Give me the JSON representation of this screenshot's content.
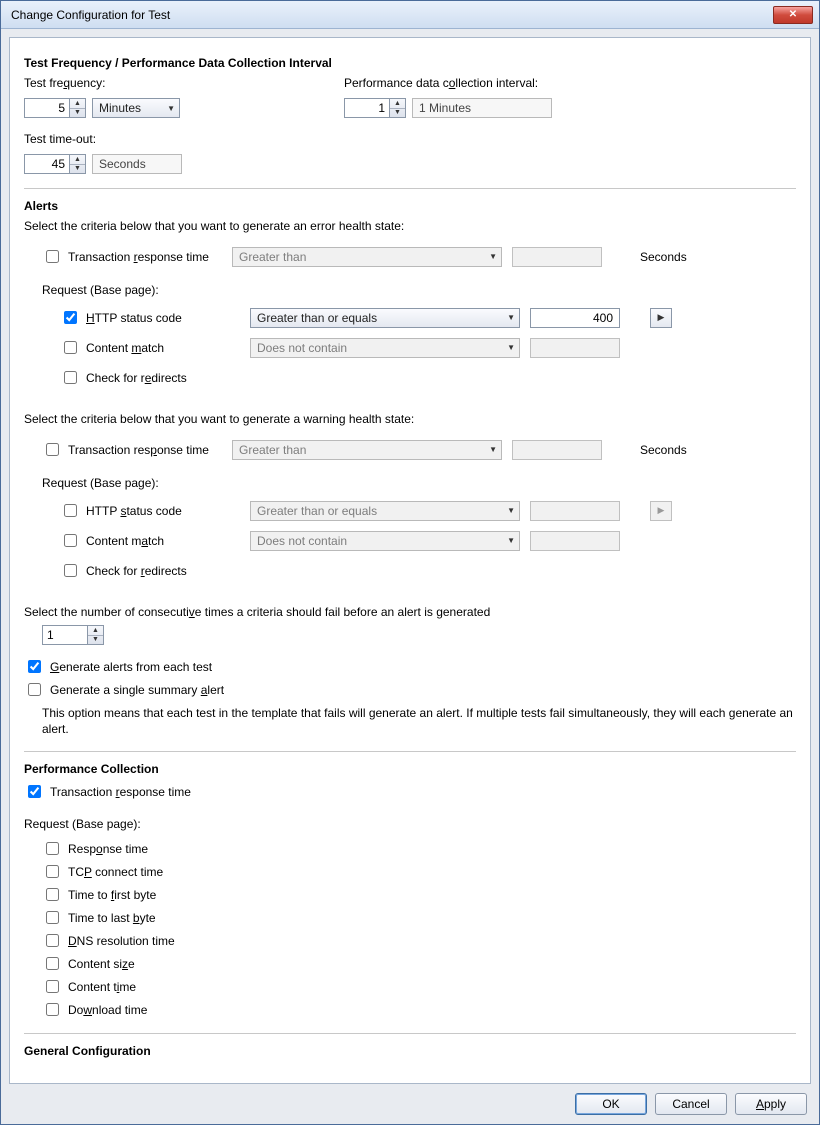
{
  "window": {
    "title": "Change Configuration for Test"
  },
  "section1": {
    "title": "Test Frequency / Performance Data Collection Interval",
    "freq_label": "Test frequency:",
    "freq_value": "5",
    "freq_unit_selected": "Minutes",
    "interval_label": "Performance data collection interval:",
    "interval_value": "1",
    "interval_display": "1 Minutes",
    "timeout_label": "Test time-out:",
    "timeout_value": "45",
    "timeout_unit": "Seconds"
  },
  "alerts": {
    "title": "Alerts",
    "error_intro": "Select the criteria below that you want to generate an error health state:",
    "warning_intro": "Select the criteria below that you want to generate a warning health state:",
    "trt_label": "Transaction response time",
    "request_label": "Request (Base page):",
    "http_label": "HTTP status code",
    "content_label": "Content match",
    "redirect_label": "Check for redirects",
    "op_gt": "Greater than",
    "op_gte": "Greater than or equals",
    "op_dnc": "Does not contain",
    "seconds": "Seconds",
    "http_error_value": "400",
    "consecutive_label": "Select the number of consecutive times a criteria should fail before an alert is generated",
    "consecutive_value": "1",
    "gen_each_label": "Generate alerts from each test",
    "gen_single_label": "Generate a single summary alert",
    "gen_desc": "This option means that each test in the template that fails will generate an alert. If multiple tests fail simultaneously, they will each generate an alert."
  },
  "perf": {
    "title": "Performance Collection",
    "trt_label": "Transaction response time",
    "request_label": "Request (Base page):",
    "items": {
      "response": "Response time",
      "tcp": "TCP connect time",
      "ttfb": "Time to first byte",
      "ttlb": "Time to last byte",
      "dns": "DNS resolution time",
      "csize": "Content size",
      "ctime": "Content time",
      "dl": "Download time"
    }
  },
  "general": {
    "title": "General Configuration"
  },
  "buttons": {
    "ok": "OK",
    "cancel": "Cancel",
    "apply": "Apply"
  }
}
